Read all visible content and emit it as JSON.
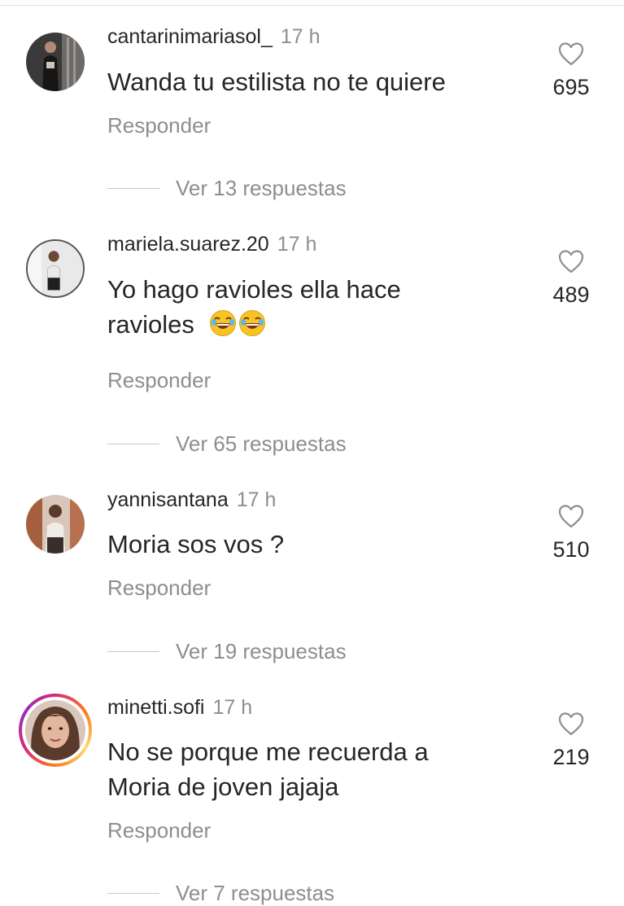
{
  "comments": [
    {
      "username": "cantarinimariasol_",
      "time": "17 h",
      "text": "Wanda tu estilista no te quiere",
      "likes": "695",
      "reply_label": "Responder",
      "view_replies": "Ver 13 respuestas",
      "avatar_icon": "avatar-photo",
      "has_story_ring": false
    },
    {
      "username": "mariela.suarez.20",
      "time": "17 h",
      "text_line1": "Yo hago ravioles ella hace",
      "text_line2": "ravioles",
      "emoji": "face-with-tears-of-joy",
      "likes": "489",
      "reply_label": "Responder",
      "view_replies": "Ver 65 respuestas",
      "avatar_icon": "avatar-photo",
      "has_story_ring": false
    },
    {
      "username": "yannisantana",
      "time": "17 h",
      "text": "Moria sos vos ?",
      "likes": "510",
      "reply_label": "Responder",
      "view_replies": "Ver 19 respuestas",
      "avatar_icon": "avatar-photo",
      "has_story_ring": false
    },
    {
      "username": "minetti.sofi",
      "time": "17 h",
      "text_line1": "No se porque me recuerda a",
      "text_line2": "Moria de joven jajaja",
      "likes": "219",
      "reply_label": "Responder",
      "view_replies": "Ver 7 respuestas",
      "avatar_icon": "avatar-photo",
      "has_story_ring": true
    }
  ],
  "colors": {
    "primary_text": "#262626",
    "secondary_text": "#8e8e8e",
    "divider": "#c7c7c7"
  }
}
